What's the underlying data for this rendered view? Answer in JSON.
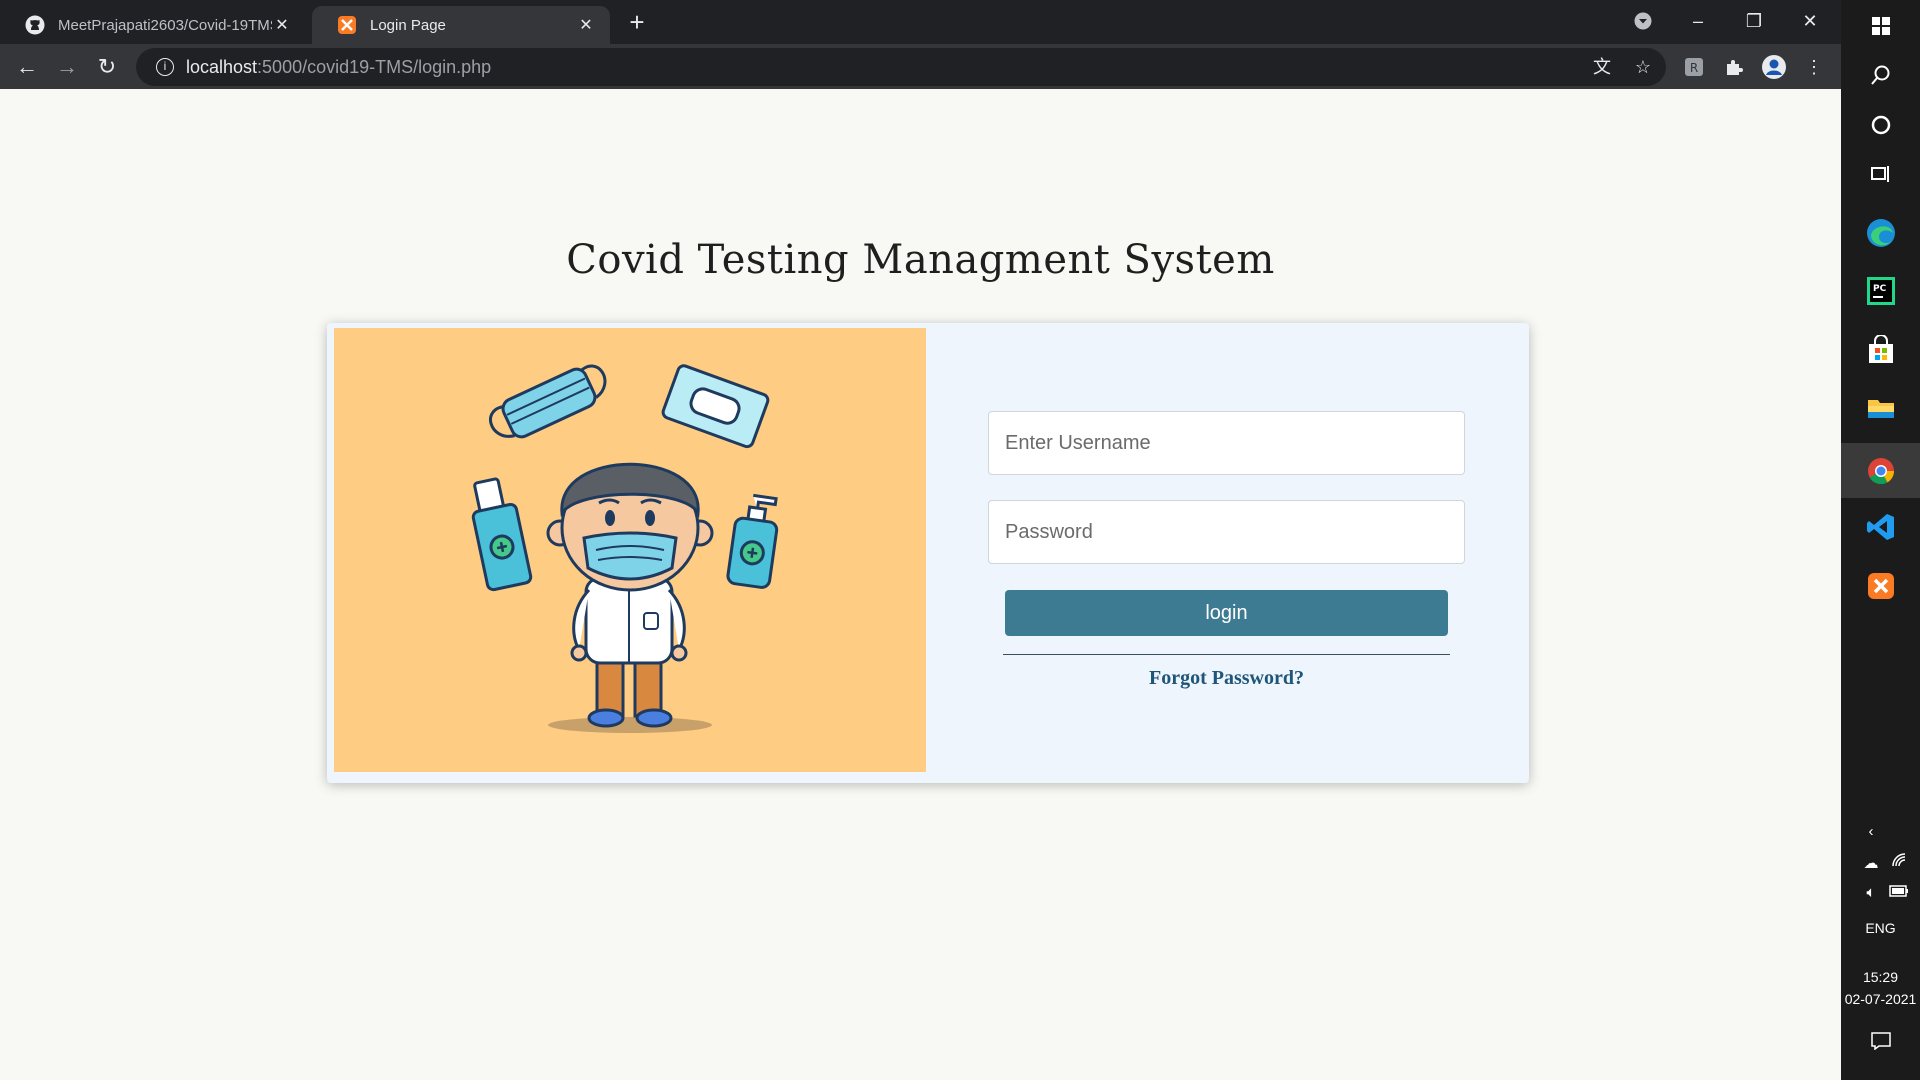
{
  "browser": {
    "tabs": [
      {
        "title": "MeetPrajapati2603/Covid-19TMS",
        "icon": "github-icon"
      },
      {
        "title": "Login Page",
        "icon": "xampp-icon"
      }
    ],
    "url_host": "localhost",
    "url_path": ":5000/covid19-TMS/login.php"
  },
  "page": {
    "heading": "Covid Testing Managment System",
    "username_placeholder": "Enter Username",
    "password_placeholder": "Password",
    "login_label": "login",
    "forgot_label": "Forgot Password?"
  },
  "taskbar": {
    "language": "ENG",
    "time": "15:29",
    "date": "02-07-2021"
  },
  "colors": {
    "illustration_bg": "#fecc82",
    "login_button": "#3d7b92",
    "card_bg": "#eef5fc"
  }
}
